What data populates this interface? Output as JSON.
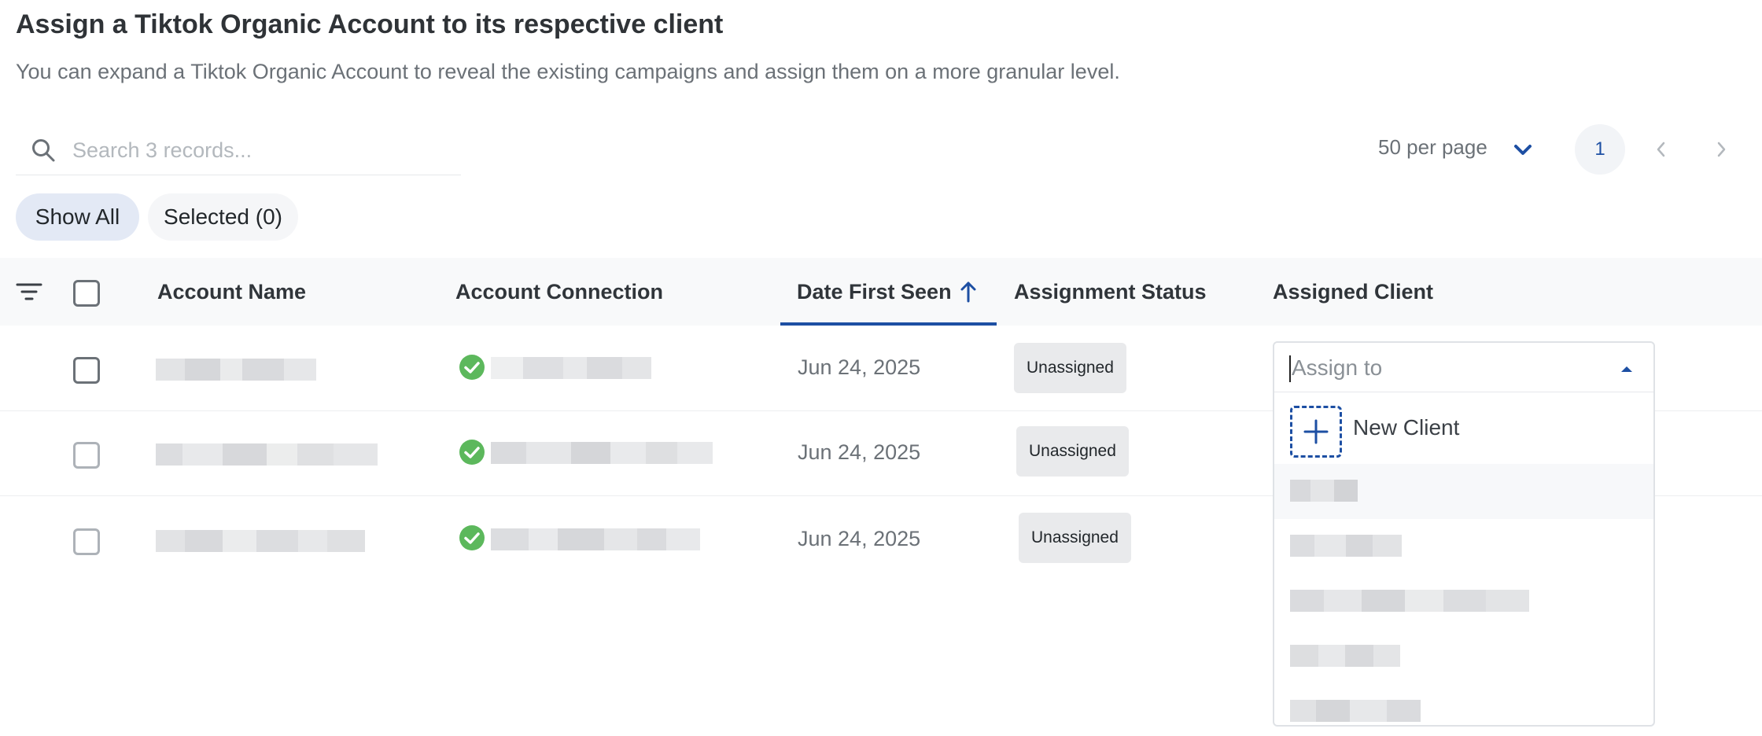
{
  "header": {
    "title": "Assign a Tiktok Organic Account to its respective client",
    "subtitle": "You can expand a Tiktok Organic Account to reveal the existing campaigns and assign them on a more granular level."
  },
  "search": {
    "placeholder": "Search 3 records...",
    "value": "",
    "icon": "search-icon"
  },
  "pagination": {
    "per_page_label": "50 per page",
    "current_page": "1"
  },
  "filters": {
    "show_all": "Show All",
    "selected": "Selected (0)"
  },
  "table": {
    "columns": [
      "Account Name",
      "Account Connection",
      "Date First Seen",
      "Assignment Status",
      "Assigned Client"
    ],
    "sorted_column": "Date First Seen",
    "sort_direction": "ascending",
    "rows": [
      {
        "account_name": "",
        "connection_status": "connected",
        "date_first_seen": "Jun 24, 2025",
        "status": "Unassigned"
      },
      {
        "account_name": "",
        "connection_status": "connected",
        "date_first_seen": "Jun 24, 2025",
        "status": "Unassigned"
      },
      {
        "account_name": "",
        "connection_status": "connected",
        "date_first_seen": "Jun 24, 2025",
        "status": "Unassigned"
      }
    ]
  },
  "dropdown": {
    "placeholder": "Assign to",
    "value": "",
    "new_client_label": "New Client",
    "options": [
      "",
      "",
      "",
      "",
      ""
    ]
  },
  "colors": {
    "accent": "#1d4fa3",
    "success": "#5cb85c",
    "badge_bg": "#e9eaec",
    "pill_active_bg": "#e3e9f5",
    "header_bg": "#f8f9fa"
  }
}
